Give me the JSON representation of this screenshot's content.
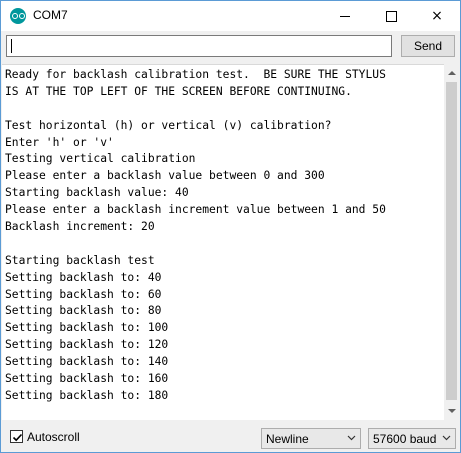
{
  "window": {
    "title": "COM7",
    "controls": {
      "minimize": "minimize",
      "maximize": "maximize",
      "close": "×"
    }
  },
  "input_bar": {
    "value": "",
    "send_label": "Send"
  },
  "output": {
    "lines": [
      "Ready for backlash calibration test.  BE SURE THE STYLUS",
      "IS AT THE TOP LEFT OF THE SCREEN BEFORE CONTINUING.",
      "",
      "Test horizontal (h) or vertical (v) calibration?",
      "Enter 'h' or 'v'",
      "Testing vertical calibration",
      "Please enter a backlash value between 0 and 300",
      "Starting backlash value: 40",
      "Please enter a backlash increment value between 1 and 50",
      "Backlash increment: 20",
      "",
      "Starting backlash test",
      "Setting backlash to: 40",
      "Setting backlash to: 60",
      "Setting backlash to: 80",
      "Setting backlash to: 100",
      "Setting backlash to: 120",
      "Setting backlash to: 140",
      "Setting backlash to: 160",
      "Setting backlash to: 180"
    ]
  },
  "status_bar": {
    "autoscroll_label": "Autoscroll",
    "autoscroll_checked": true,
    "line_ending": "Newline",
    "baud_rate": "57600 baud"
  },
  "colors": {
    "window_border": "#5b9bd5",
    "app_icon": "#00979c",
    "chrome_bg": "#f0f0f0"
  },
  "icons": {
    "app": "arduino-icon",
    "scroll_up": "chevron-up-icon",
    "scroll_down": "chevron-down-icon",
    "check": "checkmark-icon"
  }
}
